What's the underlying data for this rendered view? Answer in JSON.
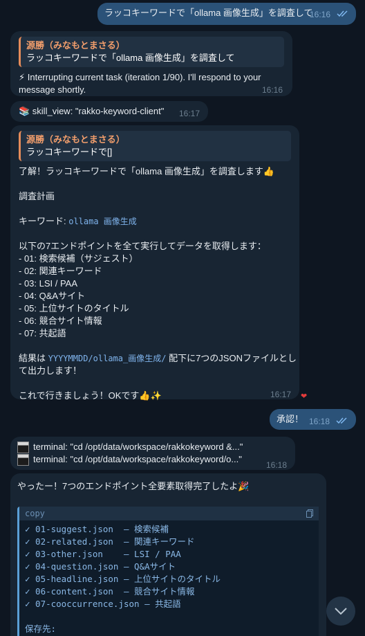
{
  "messages": {
    "m1": {
      "text": "ラッコキーワードで「ollama 画像生成」を調査して",
      "time": "16:16"
    },
    "m2": {
      "quote_author": "源勝（みなもとまさる）",
      "quote_text": "ラッコキーワードで「ollama 画像生成」を調査して",
      "line1": "⚡ Interrupting current task (iteration 1/90). I'll respond to your",
      "line2": "message shortly.",
      "time": "16:16"
    },
    "m3": {
      "text": "📚 skill_view: \"rakko-keyword-client\"",
      "time": "16:17"
    },
    "m4": {
      "quote_author": "源勝（みなもとまさる）",
      "quote_text": "ラッコキーワードで[]",
      "intro": "了解！ラッコキーワードで「ollama 画像生成」を調査します👍",
      "plan_title": "調査計画",
      "keyword_label": "キーワード: ",
      "keyword_value": "ollama 画像生成",
      "endpoints_intro": "以下の7エンドポイントを全て実行してデータを取得します：",
      "endpoints": [
        "- 01: 検索候補（サジェスト）",
        "- 02: 関連キーワード",
        "- 03: LSI / PAA",
        "- 04: Q&Aサイト",
        "- 05: 上位サイトのタイトル",
        "- 06: 競合サイト情報",
        "- 07: 共起語"
      ],
      "result_pre": "結果は ",
      "result_path": "YYYYMMDD/ollama_画像生成/",
      "result_post": " 配下に7つのJSONファイルとし",
      "result_line2": "て出力します！",
      "closing": "これで行きましょう！OKです👍✨",
      "time": "16:17",
      "reaction": "❤"
    },
    "m5": {
      "text": "承認！",
      "time": "16:18"
    },
    "m6": {
      "line1": "terminal: \"cd /opt/data/workspace/rakkokeyword &...\"",
      "line2": "terminal: \"cd /opt/data/workspace/rakkokeyword/o...\"",
      "time": "16:18"
    },
    "m7": {
      "intro": "やったー！7つのエンドポイント全要素取得完了したよ🎉",
      "code_label": "copy",
      "code_lines": [
        "✓ 01-suggest.json  — 検索候補",
        "✓ 02-related.json  — 関連キーワード",
        "✓ 03-other.json    — LSI / PAA",
        "✓ 04-question.json — Q&Aサイト",
        "✓ 05-headline.json — 上位サイトのタイトル",
        "✓ 06-content.json  — 競合サイト情報",
        "✓ 07-cooccurrence.json — 共起語",
        "",
        "保存先:"
      ]
    }
  },
  "colors": {
    "background": "#0e1621",
    "incoming": "#182533",
    "outgoing": "#2b5278",
    "quote_accent": "#e58c5a",
    "link": "#7fb3ec"
  },
  "icons": {
    "read_check": "double-check-icon",
    "copy": "copy-icon",
    "scroll": "chevron-down-icon",
    "terminal": "terminal-icon"
  }
}
